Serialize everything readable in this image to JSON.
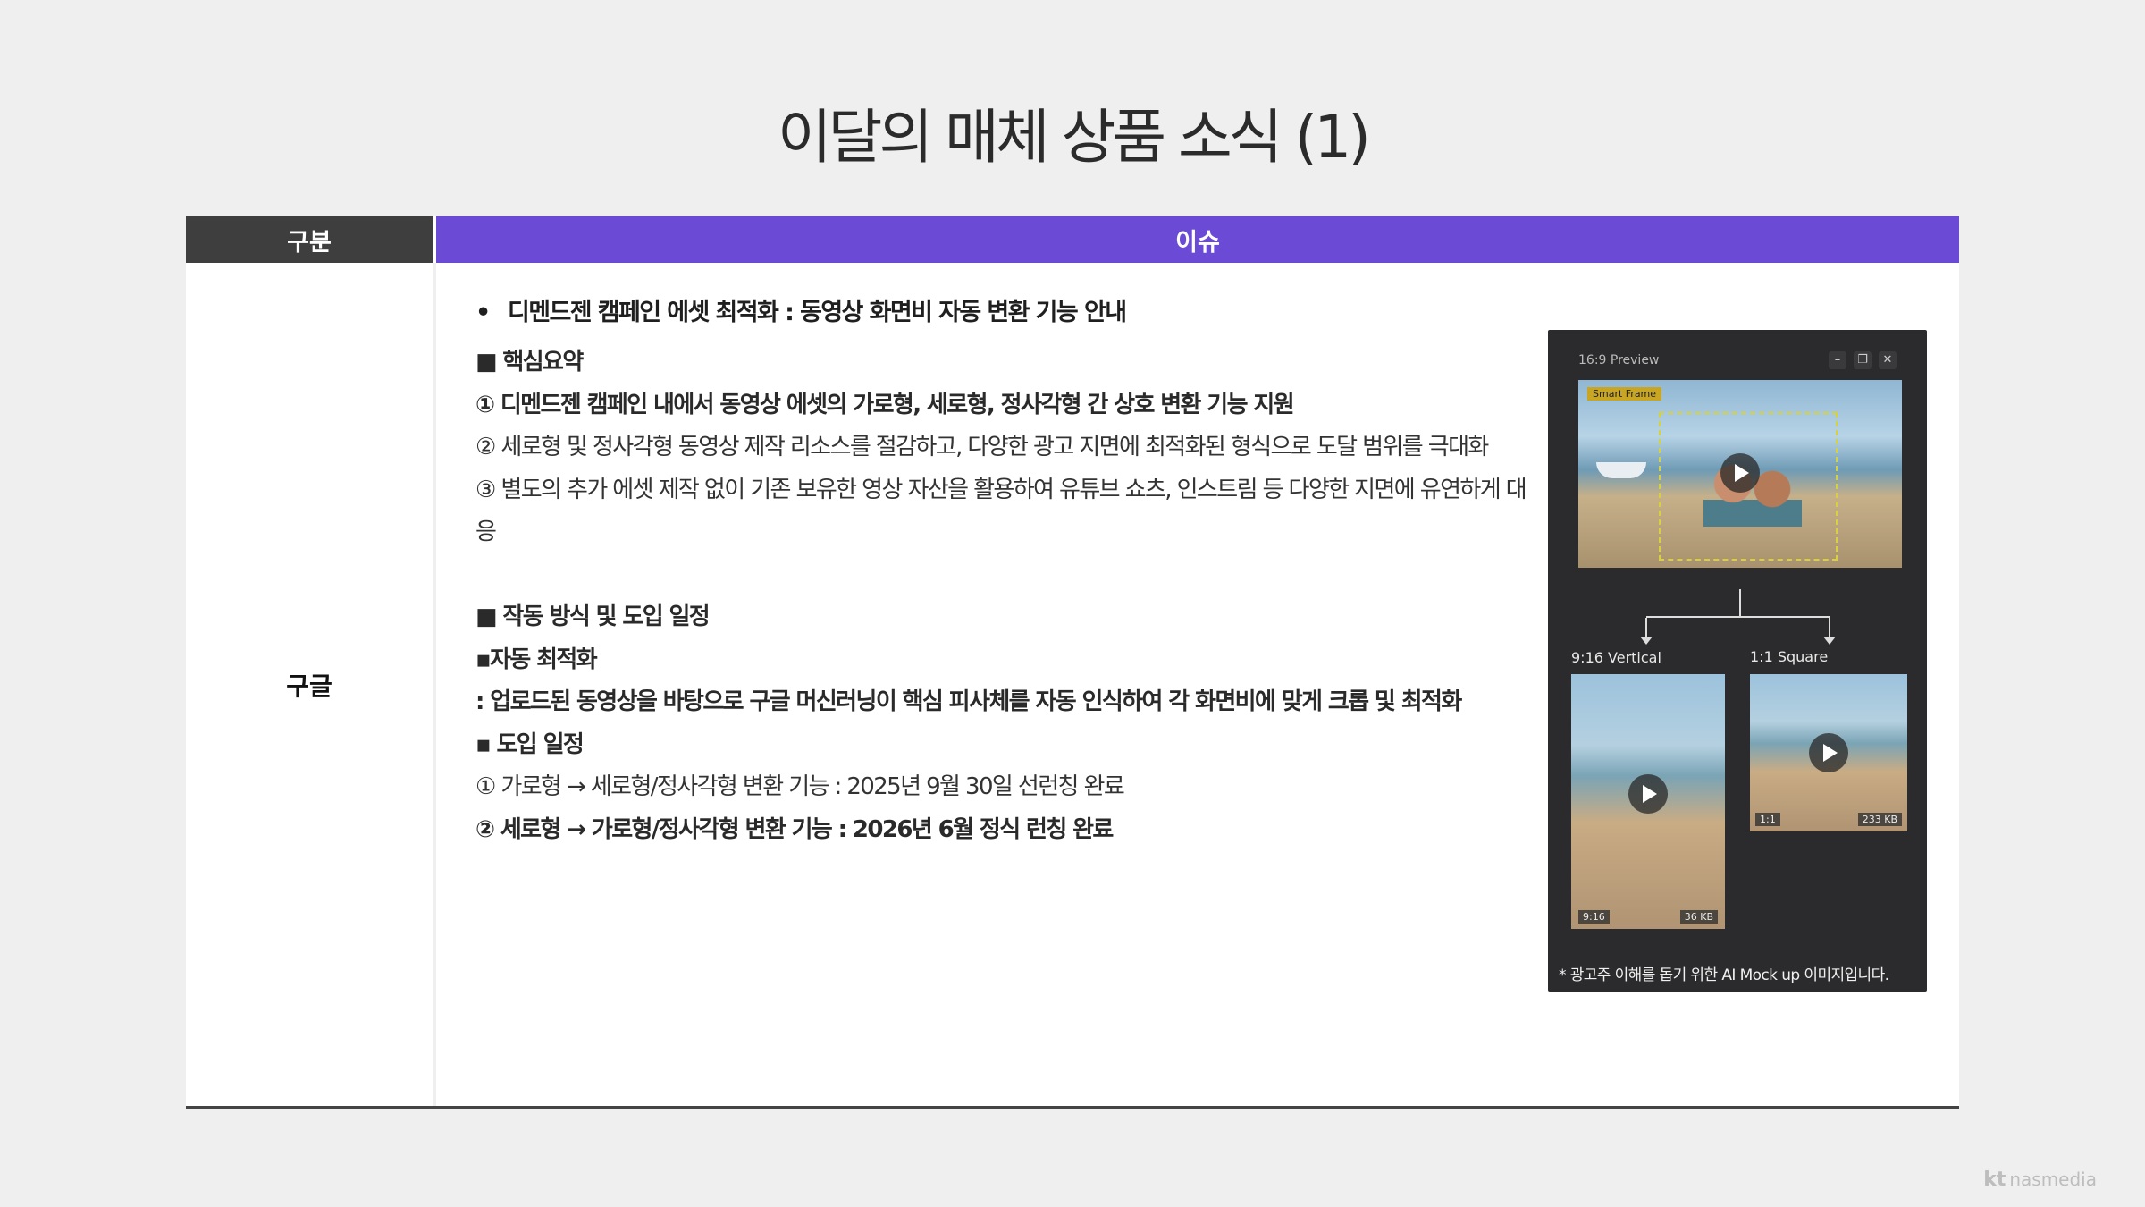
{
  "page": {
    "title": "이달의 매체 상품 소식 (1)"
  },
  "table": {
    "header_category": "구분",
    "header_issue": "이슈",
    "category": "구글"
  },
  "content": {
    "bullet": "디멘드젠 캠페인 에셋 최적화 : 동영상 화면비 자동 변환 기능 안내",
    "section1_title": "■ 핵심요약",
    "s1_l1": "① 디멘드젠 캠페인 내에서 동영상 에셋의 가로형, 세로형, 정사각형 간 상호 변환 기능 지원",
    "s1_l2": "② 세로형 및 정사각형 동영상 제작 리소스를 절감하고, 다양한 광고 지면에 최적화된 형식으로 도달 범위를 극대화",
    "s1_l3a": "③ 별도의 추가 에셋 제작 없이 기존 보유한 영상 자산을 활용하여 유튜브 쇼츠, 인스트림 등 다양한 지면에 유연하게 대",
    "s1_l3b": "응",
    "section2_title": "■ 작동 방식 및 도입 일정",
    "s2_sub1": "▪자동 최적화",
    "s2_sub1_desc": ": 업로드된 동영상을 바탕으로 구글 머신러닝이 핵심 피사체를 자동 인식하여 각 화면비에 맞게 크롭 및 최적화",
    "s2_sub2": "▪ 도입 일정",
    "s2_l1": "① 가로형 → 세로형/정사각형 변환 기능 : 2025년 9월 30일 선런칭 완료",
    "s2_l2": "② 세로형 → 가로형/정사각형 변환 기능 : 2026년 6월 정식 런칭 완료"
  },
  "mockup": {
    "preview_title": "16:9 Preview",
    "smart_frame_label": "Smart Frame",
    "vertical_label": "9:16 Vertical",
    "square_label": "1:1 Square",
    "vertical_tag_ratio": "9:16",
    "vertical_tag_size": "36 KB",
    "square_tag_ratio": "1:1",
    "square_tag_size": "233 KB",
    "note": "* 광고주 이해를 돕기 위한 AI Mock up 이미지입니다.",
    "win_min_icon": "minimize-icon",
    "win_restore_icon": "restore-icon",
    "win_close_icon": "close-icon"
  },
  "footer": {
    "logo_kt": "kt",
    "logo_text": "nasmedia"
  }
}
